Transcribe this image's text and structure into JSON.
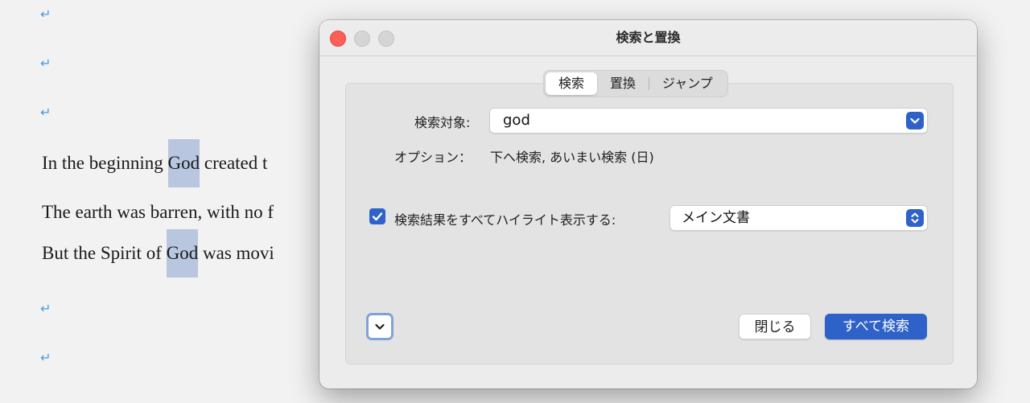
{
  "document": {
    "lines": [
      {
        "before": "In the beginning ",
        "highlight": "God",
        "after": " created t"
      },
      {
        "before": "The earth was barren, with no f",
        "highlight": "",
        "after": ""
      },
      {
        "before": "But the Spirit of ",
        "highlight": "God",
        "after": " was movi"
      }
    ],
    "paragraph_mark": "↵"
  },
  "dialog": {
    "title": "検索と置換",
    "tabs": [
      "検索",
      "置換",
      "ジャンプ"
    ],
    "active_tab": "検索",
    "search_target_label": "検索対象:",
    "search_value": "god",
    "options_label": "オプション：",
    "options_value": "下へ検索, あいまい検索 (日)",
    "highlight_all_label": "検索結果をすべてハイライト表示する:",
    "highlight_all_checked": true,
    "highlight_scope": "メイン文書",
    "close_label": "閉じる",
    "search_all_label": "すべて検索"
  },
  "colors": {
    "accent": "#2e62c9",
    "highlight": "#b8c6e0",
    "paragraph_mark": "#4a9be0",
    "close_traffic": "#fe5f57"
  }
}
